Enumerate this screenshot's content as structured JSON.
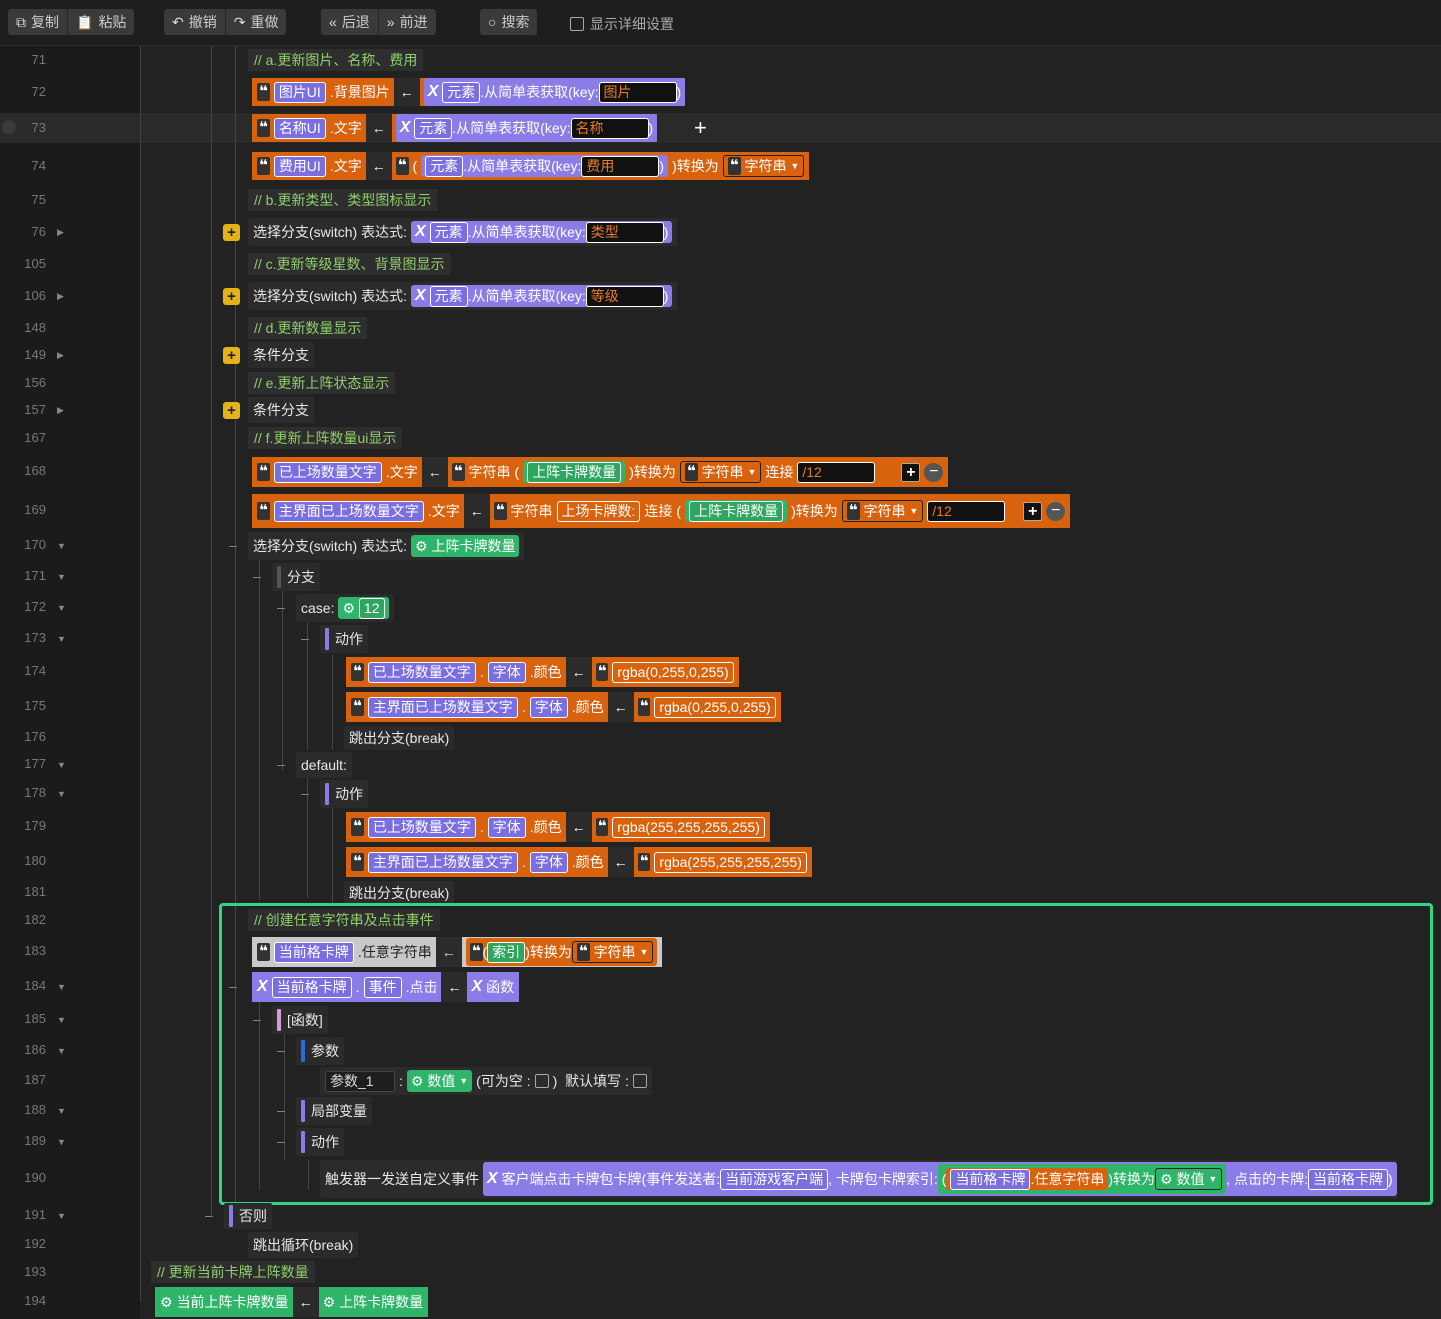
{
  "toolbar": {
    "copy": "复制",
    "paste": "粘贴",
    "undo": "撤销",
    "redo": "重做",
    "back": "后退",
    "forward": "前进",
    "search": "搜索",
    "details": "显示详细设置"
  },
  "lines": [
    "71",
    "72",
    "73",
    "74",
    "75",
    "76",
    "105",
    "106",
    "148",
    "149",
    "156",
    "157",
    "167",
    "168",
    "169",
    "170",
    "171",
    "172",
    "173",
    "174",
    "175",
    "176",
    "177",
    "178",
    "179",
    "180",
    "181",
    "182",
    "183",
    "184",
    "185",
    "186",
    "187",
    "188",
    "189",
    "190",
    "191",
    "192",
    "193",
    "194"
  ],
  "code": {
    "c71": "// a.更新图片、名称、费用",
    "r72": {
      "img_ui": "图片UI",
      "bg": ".背景图片",
      "elem": "元素",
      "get": ".从简单表获取(key:",
      "key": "图片"
    },
    "r73": {
      "name_ui": "名称UI",
      "txt": ".文字",
      "elem": "元素",
      "get": ".从简单表获取(key:",
      "key": "名称"
    },
    "r74": {
      "cost_ui": "费用UI",
      "txt": ".文字",
      "elem": "元素",
      "get": ".从简单表获取(key:",
      "key": "费用",
      "conv": ")转换为",
      "str": "字符串"
    },
    "c75": "// b.更新类型、类型图标显示",
    "r76": {
      "sw": "选择分支(switch) 表达式:",
      "elem": "元素",
      "get": ".从简单表获取(key:",
      "key": "类型"
    },
    "c105": "// c.更新等级星数、背景图显示",
    "r106": {
      "sw": "选择分支(switch) 表达式:",
      "elem": "元素",
      "get": ".从简单表获取(key:",
      "key": "等级"
    },
    "c148": "// d.更新数量显示",
    "r149": "条件分支",
    "c156": "// e.更新上阵状态显示",
    "r157": "条件分支",
    "c167": "// f.更新上阵数量ui显示",
    "r168": {
      "var": "已上场数量文字",
      "txt": ".文字",
      "strfn": "字符串",
      "num": "上阵卡牌数量",
      "conv": ")转换为",
      "str": "字符串",
      "concat": "连接",
      "val": "/12"
    },
    "r169": {
      "var": "主界面已上场数量文字",
      "txt": ".文字",
      "strfn": "字符串",
      "lit": "上场卡牌数:",
      "concat": "连接",
      "num": "上阵卡牌数量",
      "conv": ")转换为",
      "str": "字符串",
      "val": "/12"
    },
    "r170": {
      "sw": "选择分支(switch) 表达式:",
      "num": "上阵卡牌数量"
    },
    "r171": "分支",
    "r172": {
      "case": "case:",
      "val": "12"
    },
    "r173": "动作",
    "r174": {
      "var": "已上场数量文字",
      "font": "字体",
      "color": ".颜色",
      "val": "rgba(0,255,0,255)"
    },
    "r175": {
      "var": "主界面已上场数量文字",
      "font": "字体",
      "color": ".颜色",
      "val": "rgba(0,255,0,255)"
    },
    "r176": "跳出分支(break)",
    "r177": "default:",
    "r178": "动作",
    "r179": {
      "var": "已上场数量文字",
      "font": "字体",
      "color": ".颜色",
      "val": "rgba(255,255,255,255)"
    },
    "r180": {
      "var": "主界面已上场数量文字",
      "font": "字体",
      "color": ".颜色",
      "val": "rgba(255,255,255,255)"
    },
    "r181": "跳出分支(break)",
    "c182": "// 创建任意字符串及点击事件",
    "r183": {
      "var": "当前格卡牌",
      "prop": ".任意字符串",
      "idx": "索引",
      "conv": ")转换为",
      "str": "字符串"
    },
    "r184": {
      "var": "当前格卡牌",
      "ev": "事件",
      "click": ".点击",
      "fn": "函数"
    },
    "r185": "[函数]",
    "r186": "参数",
    "r187": {
      "param": "参数_1",
      "type": "数值",
      "nullable": "(可为空 :",
      "default": "默认填写 :"
    },
    "r188": "局部变量",
    "r189": "动作",
    "r190": {
      "trigger": "触发器一发送自定义事件",
      "event": "客户端点击卡牌包卡牌(事件发送者:",
      "sender": "当前游戏客户端",
      "idxlabel": ", 卡牌包卡牌索引:",
      "var": "当前格卡牌",
      "prop": ".任意字符串",
      "conv": ")转换为",
      "num": "数值",
      "clicked": ", 点击的卡牌:",
      "card": "当前格卡牌"
    },
    "r191": "否则",
    "r192": "跳出循环(break)",
    "c193": "// 更新当前卡牌上阵数量",
    "r194": {
      "lhs": "当前上阵卡牌数量",
      "rhs": "上阵卡牌数量"
    }
  }
}
